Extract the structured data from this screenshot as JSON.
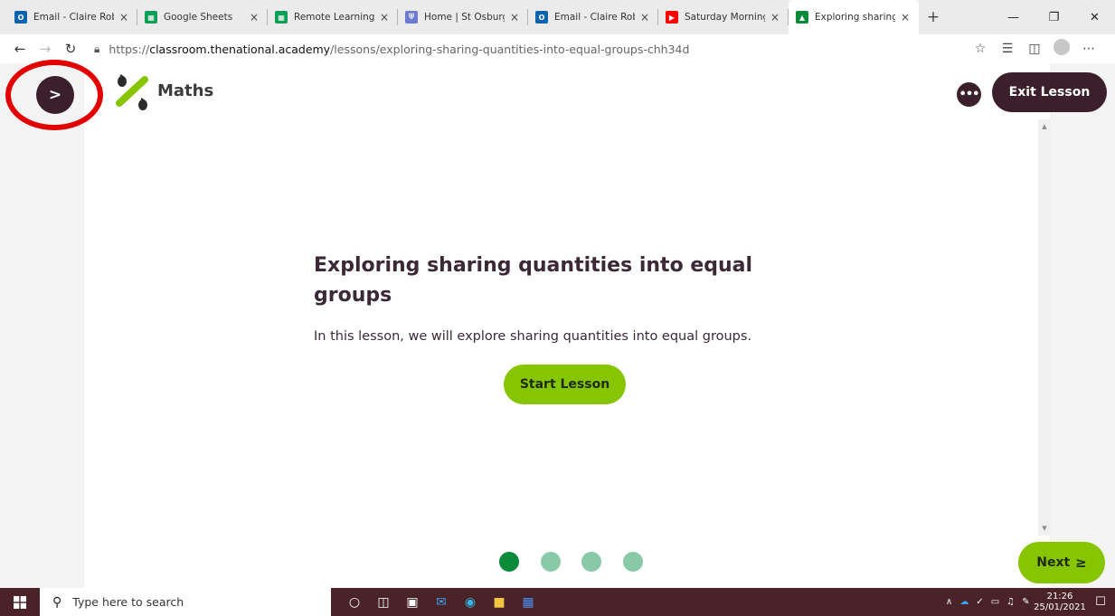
{
  "browser": {
    "tabs": [
      {
        "title": "Email - Claire Rob",
        "icon": "outlook-icon",
        "color": "#0a64ad",
        "active": false
      },
      {
        "title": "Google Sheets",
        "icon": "sheets-icon",
        "color": "#109d58",
        "active": false
      },
      {
        "title": "Remote Learning",
        "icon": "sheets-icon",
        "color": "#109d58",
        "active": false
      },
      {
        "title": "Home | St Osburg",
        "icon": "shield-icon",
        "color": "#6c7ad1",
        "active": false
      },
      {
        "title": "Email - Claire Rob",
        "icon": "outlook-icon",
        "color": "#0a64ad",
        "active": false
      },
      {
        "title": "Saturday Morning",
        "icon": "youtube-icon",
        "color": "#ff0000",
        "active": false
      },
      {
        "title": "Exploring sharing",
        "icon": "oak-icon",
        "color": "#0b8a3a",
        "active": true
      }
    ],
    "tab_close": "×",
    "new_tab": "+",
    "url_prefix": "https://",
    "url_domain": "classroom.thenational.academy",
    "url_path": "/lessons/exploring-sharing-quantities-into-equal-groups-chh34d"
  },
  "header": {
    "menu_label": ">",
    "subject": "Maths",
    "more_label": "•••",
    "exit_label": "Exit Lesson"
  },
  "lesson": {
    "title": "Exploring sharing quantities into equal groups",
    "description": "In this lesson, we will explore sharing quantities into equal groups.",
    "start_label": "Start Lesson",
    "step_count": 4,
    "active_step": 1,
    "next_label": "Next"
  },
  "taskbar": {
    "search_placeholder": "Type here to search",
    "time": "21:26",
    "date": "25/01/2021"
  },
  "colors": {
    "accent_dark": "#3b1f2b",
    "accent_green": "#86c500",
    "step_active": "#0b8a3a",
    "step_inactive": "#88c9a8",
    "highlight_red": "#e30000"
  }
}
